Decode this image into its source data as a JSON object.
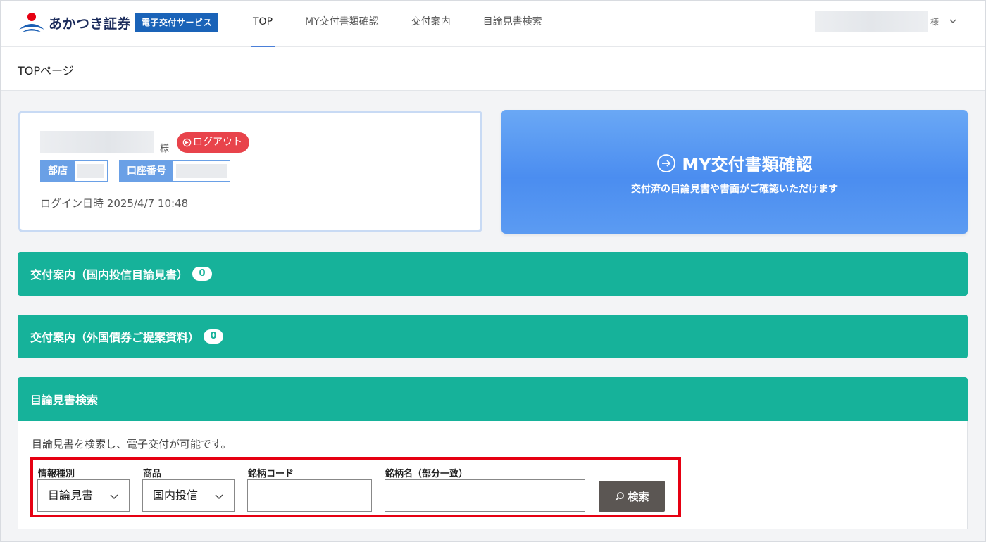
{
  "header": {
    "logo_text": "あかつき証券",
    "logo_badge": "電子交付サービス",
    "nav": [
      {
        "label": "TOP",
        "active": true
      },
      {
        "label": "MY交付書類確認",
        "active": false
      },
      {
        "label": "交付案内",
        "active": false
      },
      {
        "label": "目論見書検索",
        "active": false
      }
    ],
    "user_suffix": "様",
    "accent_color": "#4a7fd8"
  },
  "page": {
    "title": "TOPページ"
  },
  "account": {
    "suffix": "様",
    "logout_label": "ログアウト",
    "branch_label": "部店",
    "account_number_label": "口座番号",
    "login_time_label": "ログイン日時",
    "login_time_value": "2025/4/7 10:48"
  },
  "my_documents": {
    "title": "MY交付書類確認",
    "subtitle": "交付済の目論見書や書面がご確認いただけます"
  },
  "sections": [
    {
      "title": "交付案内（国内投信目論見書）",
      "count": "0"
    },
    {
      "title": "交付案内（外国債券ご提案資料）",
      "count": "0"
    }
  ],
  "search": {
    "title": "目論見書検索",
    "description": "目論見書を検索し、電子交付が可能です。",
    "info_type_label": "情報種別",
    "info_type_value": "目論見書",
    "product_label": "商品",
    "product_value": "国内投信",
    "code_label": "銘柄コード",
    "name_label": "銘柄名（部分一致）",
    "button_label": "検索"
  },
  "colors": {
    "teal": "#16b29a",
    "logout_red": "#e8434b",
    "highlight_red": "#e60012",
    "brand_blue": "#1a63b8"
  }
}
